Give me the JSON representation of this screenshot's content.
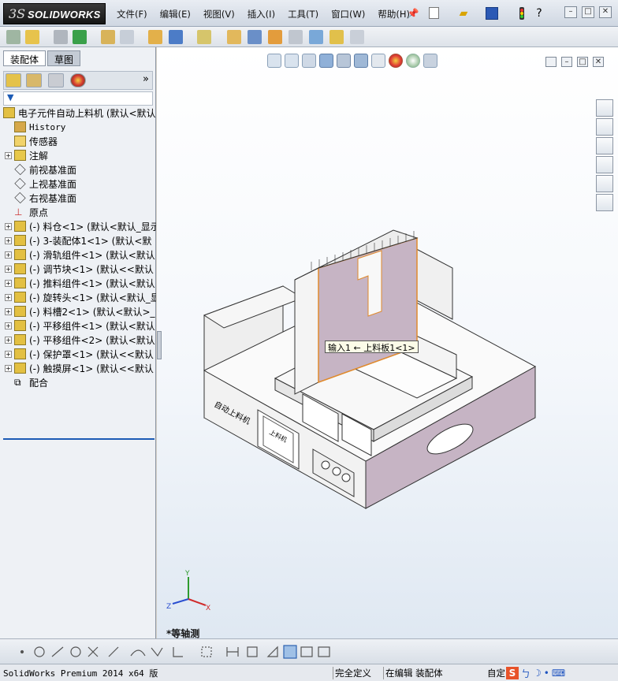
{
  "app": {
    "logo_ds": "3S",
    "logo_text": "SOLIDWORKS"
  },
  "menu": {
    "items": [
      "文件(F)",
      "编辑(E)",
      "视图(V)",
      "插入(I)",
      "工具(T)",
      "窗口(W)",
      "帮助(H)"
    ]
  },
  "left_panel": {
    "tabs": [
      "装配体",
      "草图"
    ],
    "tree": {
      "root": "电子元件自动上料机  (默认<默认",
      "items": [
        {
          "label": "History",
          "icon": "history-icon",
          "mono": true
        },
        {
          "label": "传感器",
          "icon": "sensor-icon"
        },
        {
          "label": "注解",
          "icon": "annotation-icon",
          "expander": true
        },
        {
          "label": "前视基准面",
          "icon": "plane-icon"
        },
        {
          "label": "上视基准面",
          "icon": "plane-icon"
        },
        {
          "label": "右视基准面",
          "icon": "plane-icon"
        },
        {
          "label": "原点",
          "icon": "origin-icon"
        },
        {
          "label": "(-) 料仓<1> (默认<默认_显示",
          "icon": "assembly-icon",
          "expander": true
        },
        {
          "label": "(-) 3-装配体1<1> (默认<默",
          "icon": "assembly-icon",
          "expander": true
        },
        {
          "label": "(-) 滑轨组件<1> (默认<默认",
          "icon": "assembly-icon",
          "expander": true
        },
        {
          "label": "(-) 调节块<1> (默认<<默认",
          "icon": "assembly-icon",
          "expander": true
        },
        {
          "label": "(-) 推料组件<1> (默认<默认",
          "icon": "assembly-icon",
          "expander": true
        },
        {
          "label": "(-) 旋转头<1> (默认<默认_显",
          "icon": "assembly-icon",
          "expander": true
        },
        {
          "label": "(-) 料槽2<1> (默认<默认>_",
          "icon": "assembly-icon",
          "expander": true
        },
        {
          "label": "(-) 平移组件<1> (默认<默认",
          "icon": "assembly-icon",
          "expander": true
        },
        {
          "label": "(-) 平移组件<2> (默认<默认",
          "icon": "assembly-icon",
          "expander": true
        },
        {
          "label": "(-) 保护罩<1> (默认<<默认",
          "icon": "assembly-icon",
          "expander": true
        },
        {
          "label": "(-) 触摸屏<1> (默认<<默认",
          "icon": "assembly-icon",
          "expander": true
        },
        {
          "label": "配合",
          "icon": "mates-icon"
        }
      ]
    }
  },
  "graphics": {
    "view_label": "*等轴测",
    "callout": "输入1 ← 上料板1<1>",
    "panel_label_1": "自动上料机",
    "panel_label_2": "上料机"
  },
  "status": {
    "left": "SolidWorks Premium 2014 x64 版",
    "definition": "完全定义",
    "editing": "在编辑 装配体",
    "custom": "自定"
  },
  "colors": {
    "accent": "#1c5bb5",
    "selection": "#c6b4c4",
    "highlight": "#e08a2c"
  }
}
